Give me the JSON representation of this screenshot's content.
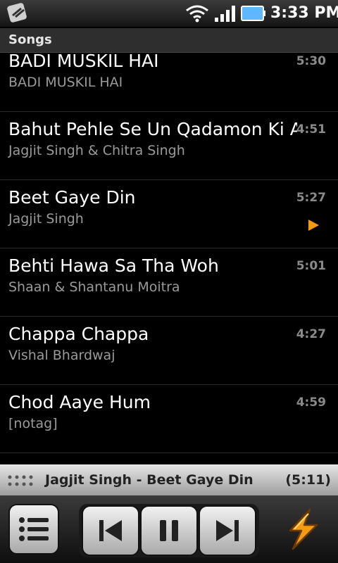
{
  "status_bar": {
    "time": "3:33 PM",
    "icons": [
      "app-icon",
      "wifi-icon",
      "signal-icon",
      "battery-icon"
    ]
  },
  "section": {
    "title": "Songs"
  },
  "songs": [
    {
      "title": "BADI MUSKIL HAI",
      "artist": "BADI MUSKIL HAI",
      "duration": "5:30",
      "playing": false
    },
    {
      "title": "Bahut Pehle Se Un Qadamon Ki Aahat",
      "artist": "Jagjit Singh & Chitra Singh",
      "duration": "4:51",
      "playing": false
    },
    {
      "title": "Beet Gaye Din",
      "artist": "Jagjit Singh",
      "duration": "5:27",
      "playing": true
    },
    {
      "title": "Behti Hawa Sa Tha Woh",
      "artist": "Shaan & Shantanu Moitra",
      "duration": "5:01",
      "playing": false
    },
    {
      "title": "Chappa Chappa",
      "artist": "Vishal Bhardwaj",
      "duration": "4:27",
      "playing": false
    },
    {
      "title": "Chod Aaye Hum",
      "artist": "[notag]",
      "duration": "4:59",
      "playing": false
    }
  ],
  "now_playing": {
    "text": "Jagjit Singh - Beet Gaye Din",
    "time": "(5:11)"
  },
  "controls": {
    "buttons": [
      "playlist-icon",
      "previous-icon",
      "pause-icon",
      "next-icon",
      "lightning-bolt-icon"
    ]
  },
  "colors": {
    "accent": "#f39c12",
    "secondary_text": "#9a9a9a",
    "duration_text": "#8a8a8a"
  }
}
